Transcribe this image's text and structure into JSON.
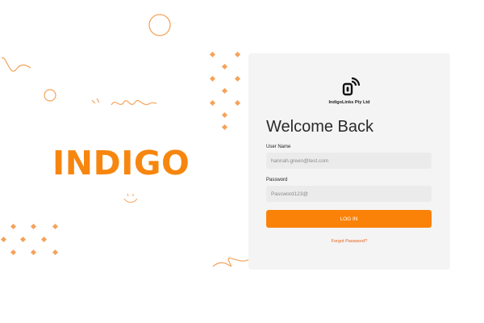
{
  "brand": {
    "name": "INDIGO",
    "color": "#f7860f"
  },
  "login_card": {
    "logo_icon": "wifi-phone-icon",
    "company": "IndigoLinks Pty Ltd",
    "title": "Welcome Back",
    "username": {
      "label": "User Name",
      "placeholder": "hannah.green@test.com"
    },
    "password": {
      "label": "Password",
      "placeholder": "Password123@"
    },
    "login_button": "LOG IN",
    "forgot_link": "Forgot Password?"
  },
  "colors": {
    "accent": "#fb8209",
    "card_background": "#f4f4f4",
    "input_background": "#ebebeb",
    "link": "#e3641b",
    "decoration": "#f5a35a"
  }
}
